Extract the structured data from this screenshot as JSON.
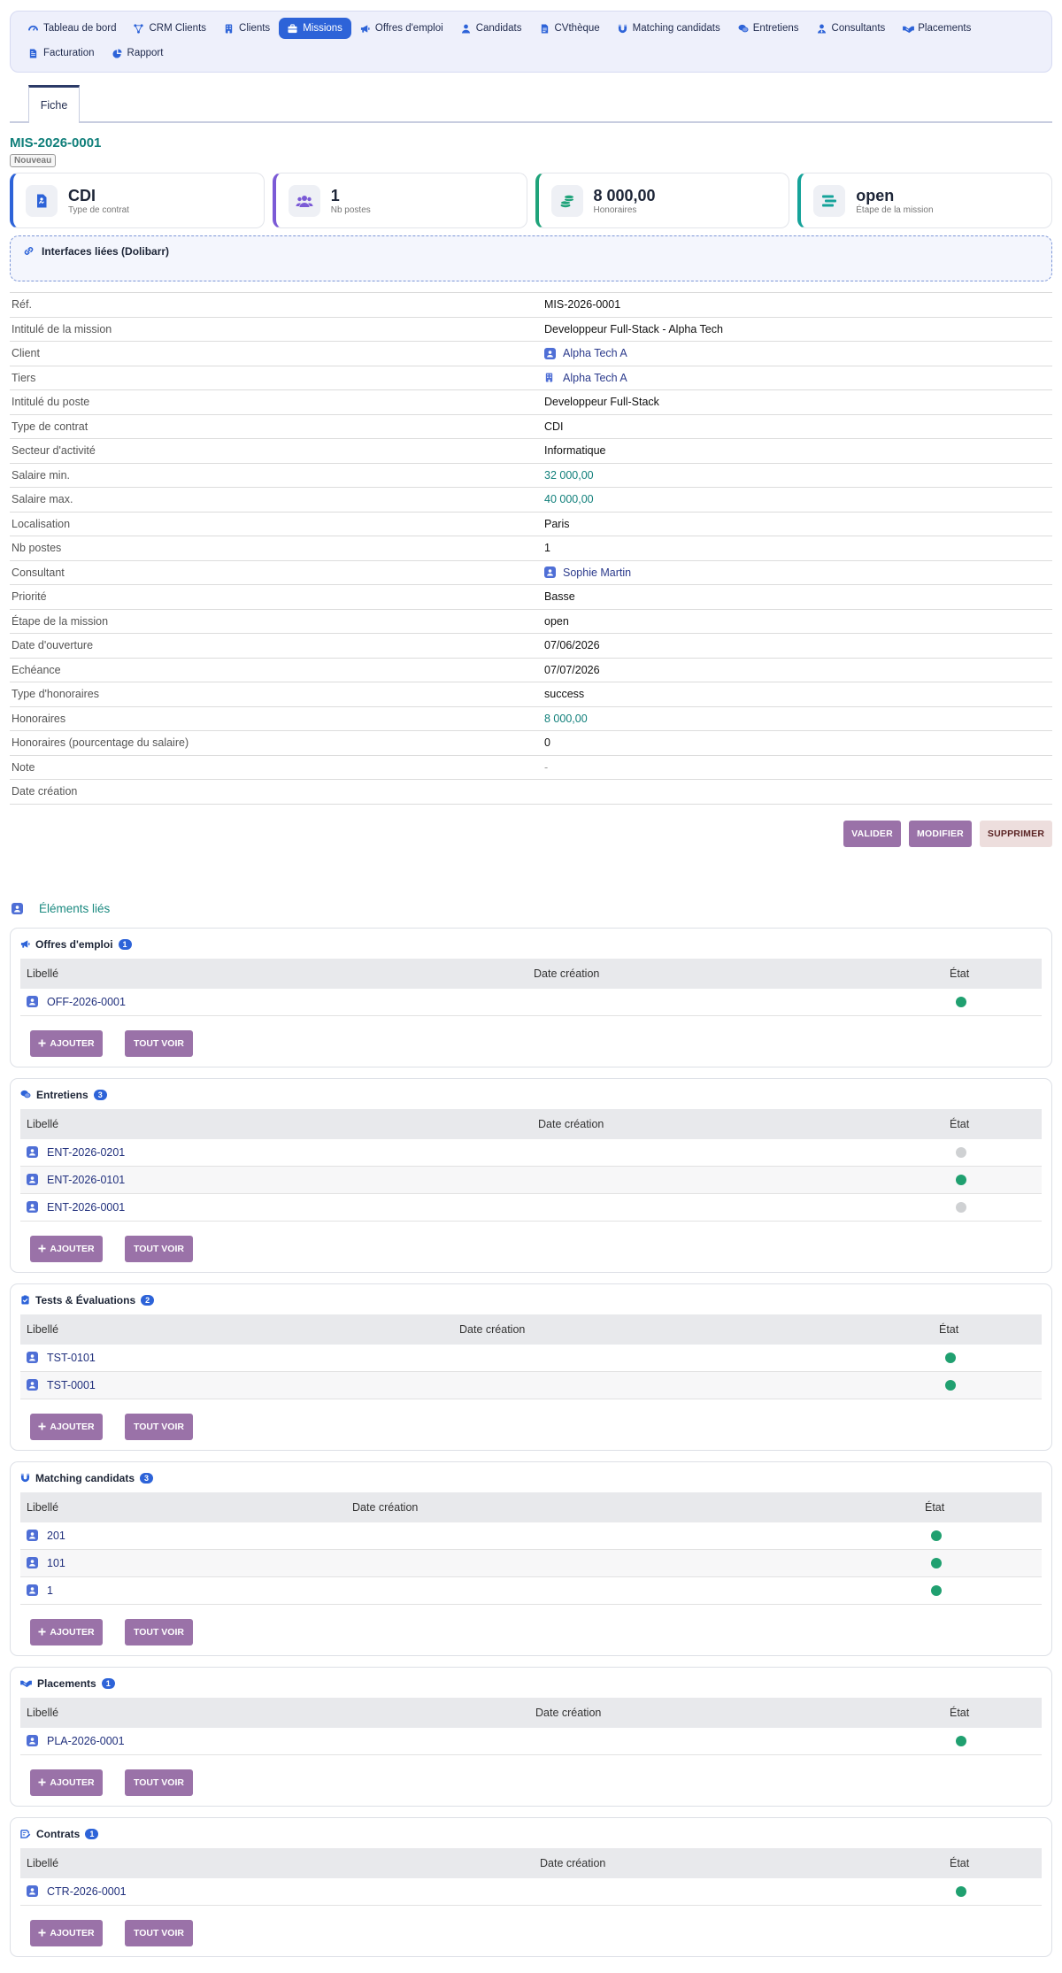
{
  "nav": [
    {
      "label": "Tableau de bord",
      "icon": "dashboard-icon",
      "active": false
    },
    {
      "label": "CRM Clients",
      "icon": "network-icon",
      "active": false
    },
    {
      "label": "Clients",
      "icon": "building-icon",
      "active": false
    },
    {
      "label": "Missions",
      "icon": "briefcase-icon",
      "active": true
    },
    {
      "label": "Offres d'emploi",
      "icon": "megaphone-icon",
      "active": false
    },
    {
      "label": "Candidats",
      "icon": "user-icon",
      "active": false
    },
    {
      "label": "CVthèque",
      "icon": "document-icon",
      "active": false
    },
    {
      "label": "Matching candidats",
      "icon": "magnet-icon",
      "active": false
    },
    {
      "label": "Entretiens",
      "icon": "chat-icon",
      "active": false
    },
    {
      "label": "Consultants",
      "icon": "user-tie-icon",
      "active": false
    },
    {
      "label": "Placements",
      "icon": "handshake-icon",
      "active": false
    },
    {
      "label": "Facturation",
      "icon": "invoice-icon",
      "active": false
    },
    {
      "label": "Rapport",
      "icon": "pie-chart-icon",
      "active": false
    }
  ],
  "tabs": {
    "fiche": "Fiche"
  },
  "mission": {
    "ref": "MIS-2026-0001",
    "status": "Nouveau"
  },
  "kpis": [
    {
      "value": "CDI",
      "label": "Type de contrat",
      "accent": "#2d63d8",
      "icon": "contract-icon",
      "iconColor": "#2d63d8"
    },
    {
      "value": "1",
      "label": "Nb postes",
      "accent": "#7b5ad6",
      "icon": "users-icon",
      "iconColor": "#7b5ad6"
    },
    {
      "value": "8 000,00",
      "label": "Honoraires",
      "accent": "#1fa37a",
      "icon": "coins-icon",
      "iconColor": "#1fa37a"
    },
    {
      "value": "open",
      "label": "Étape de la mission",
      "accent": "#16a39a",
      "icon": "stages-icon",
      "iconColor": "#16a39a"
    }
  ],
  "interfaces": {
    "title": "Interfaces liées (Dolibarr)"
  },
  "details": [
    {
      "label": "Réf.",
      "value": "MIS-2026-0001",
      "kind": "text"
    },
    {
      "label": "Intitulé de la mission",
      "value": "Developpeur Full-Stack - Alpha Tech",
      "kind": "text"
    },
    {
      "label": "Client",
      "value": "Alpha Tech A",
      "kind": "link",
      "icon": "client-icon"
    },
    {
      "label": "Tiers",
      "value": "Alpha Tech A",
      "kind": "link",
      "icon": "building-icon"
    },
    {
      "label": "Intitulé du poste",
      "value": "Developpeur Full-Stack",
      "kind": "text"
    },
    {
      "label": "Type de contrat",
      "value": "CDI",
      "kind": "text"
    },
    {
      "label": "Secteur d'activité",
      "value": "Informatique",
      "kind": "text"
    },
    {
      "label": "Salaire min.",
      "value": "32 000,00",
      "kind": "money"
    },
    {
      "label": "Salaire max.",
      "value": "40 000,00",
      "kind": "money"
    },
    {
      "label": "Localisation",
      "value": "Paris",
      "kind": "text"
    },
    {
      "label": "Nb postes",
      "value": "1",
      "kind": "text"
    },
    {
      "label": "Consultant",
      "value": "Sophie Martin",
      "kind": "link",
      "icon": "user-icon"
    },
    {
      "label": "Priorité",
      "value": "Basse",
      "kind": "text"
    },
    {
      "label": "Étape de la mission",
      "value": "open",
      "kind": "text"
    },
    {
      "label": "Date d'ouverture",
      "value": "07/06/2026",
      "kind": "text"
    },
    {
      "label": "Echéance",
      "value": "07/07/2026",
      "kind": "text"
    },
    {
      "label": "Type d'honoraires",
      "value": "success",
      "kind": "text"
    },
    {
      "label": "Honoraires",
      "value": "8 000,00",
      "kind": "money"
    },
    {
      "label": "Honoraires (pourcentage du salaire)",
      "value": "0",
      "kind": "text"
    },
    {
      "label": "Note",
      "value": "-",
      "kind": "muted"
    },
    {
      "label": "Date création",
      "value": "",
      "kind": "text"
    }
  ],
  "actions": {
    "validate": "VALIDER",
    "edit": "MODIFIER",
    "delete": "SUPPRIMER"
  },
  "linked": {
    "title": "Éléments liés"
  },
  "panels": [
    {
      "title": "Offres d'emploi",
      "count": "1",
      "icon": "megaphone-icon",
      "cols": [
        "Libellé",
        "Date création",
        "État"
      ],
      "w1": 580,
      "w2": 470,
      "rows": [
        {
          "label": "OFF-2026-0001",
          "date": "",
          "state": "green"
        }
      ]
    },
    {
      "title": "Entretiens",
      "count": "3",
      "icon": "chat-icon",
      "cols": [
        "Libellé",
        "Date création",
        "État"
      ],
      "w1": 585,
      "w2": 465,
      "rows": [
        {
          "label": "ENT-2026-0201",
          "date": "",
          "state": "grey"
        },
        {
          "label": "ENT-2026-0101",
          "date": "",
          "state": "green"
        },
        {
          "label": "ENT-2026-0001",
          "date": "",
          "state": "grey"
        }
      ]
    },
    {
      "title": "Tests & Évaluations",
      "count": "2",
      "icon": "clipboard-icon",
      "cols": [
        "Libellé",
        "Date création",
        "État"
      ],
      "w1": 496,
      "w2": 542,
      "rows": [
        {
          "label": "TST-0101",
          "date": "",
          "state": "green"
        },
        {
          "label": "TST-0001",
          "date": "",
          "state": "green"
        }
      ]
    },
    {
      "title": "Matching candidats",
      "count": "3",
      "icon": "magnet-icon",
      "cols": [
        "Libellé",
        "Date création",
        "État"
      ],
      "w1": 375,
      "w2": 647,
      "rows": [
        {
          "label": "201",
          "date": "",
          "state": "green"
        },
        {
          "label": "101",
          "date": "",
          "state": "green"
        },
        {
          "label": "1",
          "date": "",
          "state": "green"
        }
      ]
    },
    {
      "title": "Placements",
      "count": "1",
      "icon": "handshake-icon",
      "cols": [
        "Libellé",
        "Date création",
        "État"
      ],
      "w1": 582,
      "w2": 468,
      "rows": [
        {
          "label": "PLA-2026-0001",
          "date": "",
          "state": "green"
        }
      ]
    },
    {
      "title": "Contrats",
      "count": "1",
      "icon": "signature-icon",
      "cols": [
        "Libellé",
        "Date création",
        "État"
      ],
      "w1": 587,
      "w2": 463,
      "rows": [
        {
          "label": "CTR-2026-0001",
          "date": "",
          "state": "green"
        }
      ]
    }
  ],
  "panel_buttons": {
    "add": "AJOUTER",
    "all": "TOUT VOIR"
  }
}
